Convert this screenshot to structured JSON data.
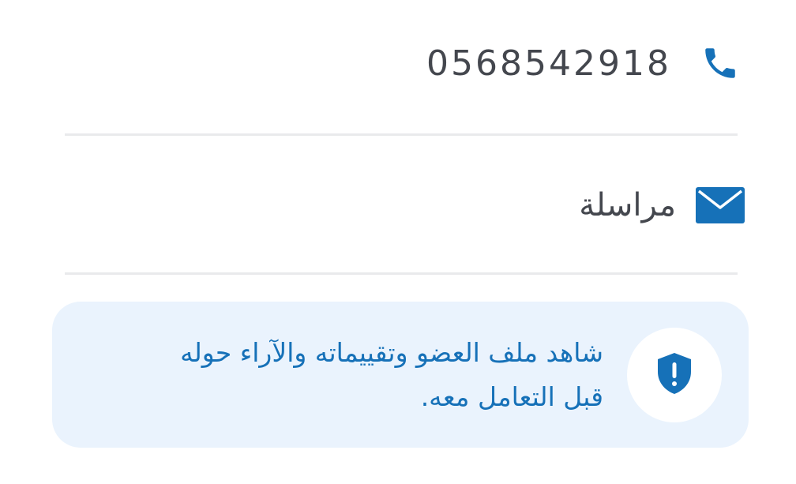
{
  "contact": {
    "phone_number": "0568542918",
    "phone_icon": "phone-icon",
    "message_label": "مراسلة",
    "message_icon": "envelope-icon"
  },
  "notice": {
    "icon": "shield-alert-icon",
    "line1": "شاهد ملف العضو وتقييماته والآراء حوله",
    "line2": "قبل التعامل معه."
  },
  "colors": {
    "accent": "#1671b8",
    "text": "#44474e",
    "card_background": "#eaf3fd",
    "divider": "#e9eaec"
  }
}
